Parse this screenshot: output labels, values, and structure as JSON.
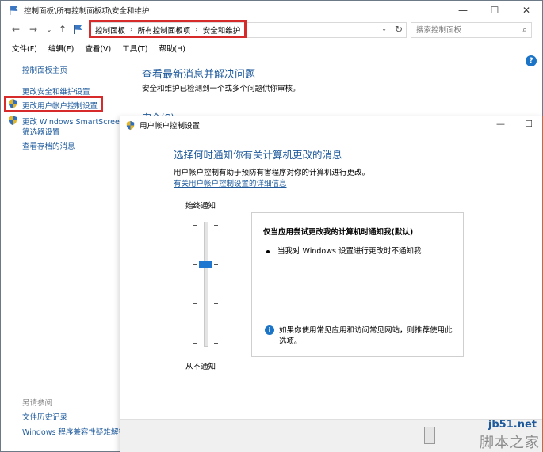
{
  "window": {
    "title": "控制面板\\所有控制面板项\\安全和维护",
    "controls": [
      "—",
      "☐",
      "✕"
    ]
  },
  "address": {
    "crumbs": [
      "控制面板",
      "所有控制面板项",
      "安全和维护"
    ],
    "search_placeholder": "搜索控制面板"
  },
  "menu": [
    "文件(F)",
    "编辑(E)",
    "查看(V)",
    "工具(T)",
    "帮助(H)"
  ],
  "sidebar": {
    "home": "控制面板主页",
    "items": [
      "更改安全和维护设置",
      "更改用户帐户控制设置",
      "更改 Windows SmartScreen",
      "筛选器设置",
      "查看存档的消息"
    ],
    "see_also": "另请参阅",
    "footer": [
      "文件历史记录",
      "Windows 程序兼容性疑难解答"
    ]
  },
  "main": {
    "title": "查看最新消息并解决问题",
    "subtitle": "安全和维护已检测到一个或多个问题供你审核。",
    "section": "安全(S)"
  },
  "dialog": {
    "title": "用户帐户控制设置",
    "heading": "选择何时通知你有关计算机更改的消息",
    "description": "用户帐户控制有助于预防有害程序对你的计算机进行更改。",
    "link": "有关用户帐户控制设置的详细信息",
    "slider_top": "始终通知",
    "slider_bottom": "从不通知",
    "slider_level": 3,
    "slider_levels": 4,
    "info_title": "仅当应用尝试更改我的计算机时通知我(默认)",
    "info_bullet": "当我对 Windows 设置进行更改时不通知我",
    "info_note": "如果你使用常见应用和访问常见网站，则推荐使用此选项。"
  },
  "watermark": {
    "line1": "jb51.net",
    "line2": "脚本之家"
  },
  "colors": {
    "link": "#1e5a9c",
    "highlight": "#d72a2a",
    "slider_thumb": "#1f77d0"
  }
}
